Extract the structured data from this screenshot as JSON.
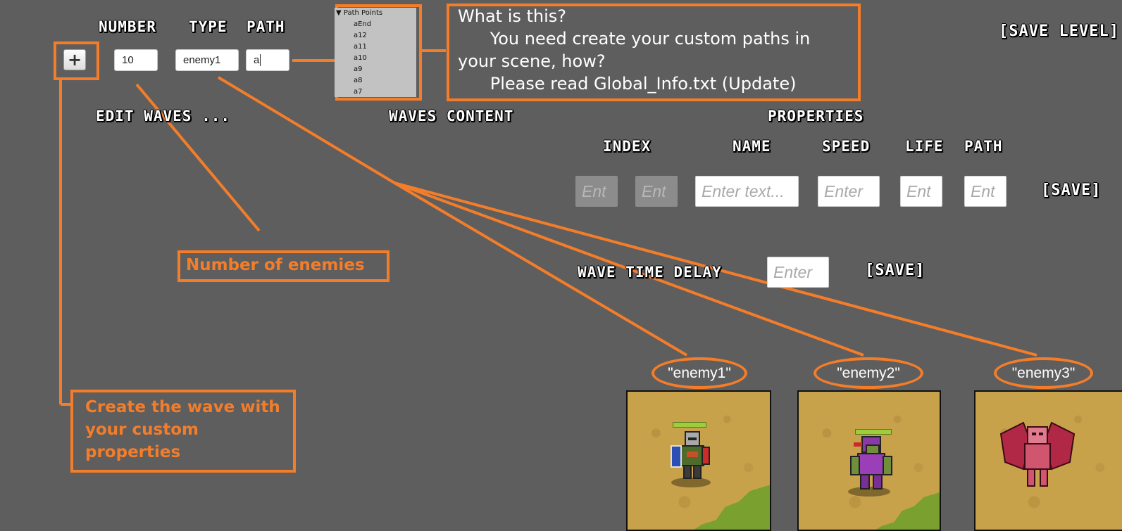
{
  "header": {
    "number_label": "NUMBER",
    "type_label": "TYPE",
    "path_label": "PATH",
    "save_level_label": "[SAVE LEVEL]"
  },
  "inputs": {
    "plus_label": "+",
    "number_value": "10",
    "type_value": "enemy1",
    "path_value": "a"
  },
  "path_points": {
    "header": "Path Points",
    "items": [
      "aEnd",
      "a12",
      "a11",
      "a10",
      "a9",
      "a8",
      "a7"
    ]
  },
  "info_box": {
    "line1": "What is this?",
    "line2": "      You need create your custom paths in",
    "line3": "your scene, how?",
    "line4": "      Please read Global_Info.txt (Update)"
  },
  "sections": {
    "edit_waves": "EDIT WAVES ...",
    "waves_content": "WAVES CONTENT",
    "properties": "PROPERTIES"
  },
  "properties": {
    "index_label": "INDEX",
    "name_label": "NAME",
    "speed_label": "SPEED",
    "life_label": "LIFE",
    "path_label": "PATH",
    "index_placeholder_1": "Ent",
    "index_placeholder_2": "Ent",
    "name_placeholder": "Enter text...",
    "speed_placeholder": "Enter",
    "life_placeholder": "Ent",
    "path_placeholder": "Ent",
    "save_label": "[SAVE]"
  },
  "wave_delay": {
    "label": "WAVE TIME DELAY",
    "placeholder": "Enter",
    "save_label": "[SAVE]"
  },
  "annotations": {
    "number_of_enemies": "Number of enemies",
    "create_wave": "Create the wave with your custom properties"
  },
  "enemies": [
    {
      "label": "\"enemy1\""
    },
    {
      "label": "\"enemy2\""
    },
    {
      "label": "\"enemy3\""
    }
  ],
  "colors": {
    "background": "#5e5e5e",
    "accent": "#f47d2a",
    "sand": "#c8a24a",
    "grass": "#7aa030"
  }
}
